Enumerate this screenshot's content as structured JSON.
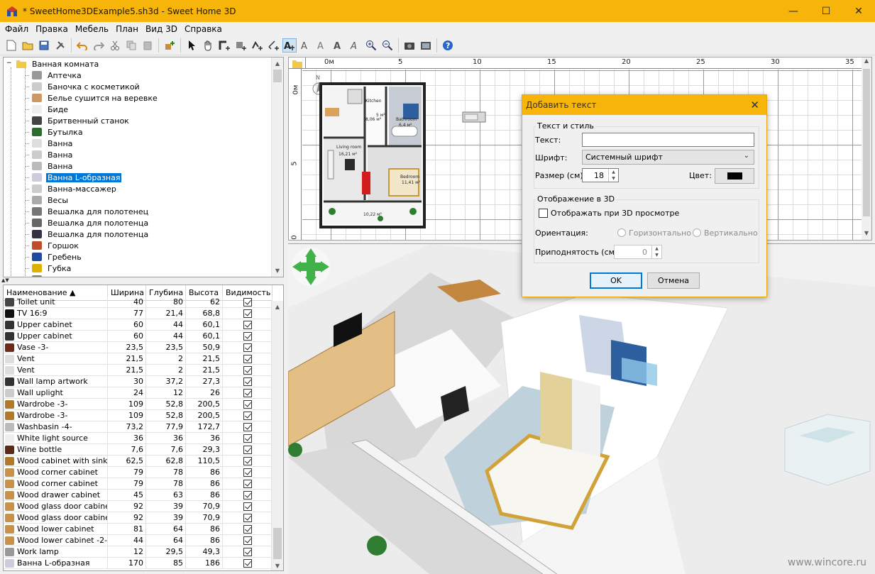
{
  "window": {
    "title": "* SweetHome3DExample5.sh3d - Sweet Home 3D",
    "minimize": "—",
    "maximize": "☐",
    "close": "✕"
  },
  "menu": [
    "Файл",
    "Правка",
    "Мебель",
    "План",
    "Вид 3D",
    "Справка"
  ],
  "catalog": {
    "category": "Ванная комната",
    "items": [
      "Аптечка",
      "Баночка с косметикой",
      "Белье сушится на веревке",
      "Биде",
      "Бритвенный станок",
      "Бутылка",
      "Ванна",
      "Ванна",
      "Ванна",
      "Ванна L-образная",
      "Ванна-массажер",
      "Весы",
      "Вешалка для полотенец",
      "Вешалка для полотенца",
      "Вешалка для полотенца",
      "Горшок",
      "Гребень",
      "Губка",
      "Дверь в душ"
    ],
    "selected_index": 9
  },
  "furniture_table": {
    "columns": [
      "Наименование ▲",
      "Ширина",
      "Глубина",
      "Высота",
      "Видимость"
    ],
    "rows": [
      {
        "name": "Toilet unit",
        "w": "40",
        "d": "80",
        "h": "62"
      },
      {
        "name": "TV 16:9",
        "w": "77",
        "d": "21,4",
        "h": "68,8"
      },
      {
        "name": "Upper cabinet",
        "w": "60",
        "d": "44",
        "h": "60,1"
      },
      {
        "name": "Upper cabinet",
        "w": "60",
        "d": "44",
        "h": "60,1"
      },
      {
        "name": "Vase -3-",
        "w": "23,5",
        "d": "23,5",
        "h": "50,9"
      },
      {
        "name": "Vent",
        "w": "21,5",
        "d": "2",
        "h": "21,5"
      },
      {
        "name": "Vent",
        "w": "21,5",
        "d": "2",
        "h": "21,5"
      },
      {
        "name": "Wall lamp artwork",
        "w": "30",
        "d": "37,2",
        "h": "27,3"
      },
      {
        "name": "Wall uplight",
        "w": "24",
        "d": "12",
        "h": "26"
      },
      {
        "name": "Wardrobe -3-",
        "w": "109",
        "d": "52,8",
        "h": "200,5"
      },
      {
        "name": "Wardrobe -3-",
        "w": "109",
        "d": "52,8",
        "h": "200,5"
      },
      {
        "name": "Washbasin -4-",
        "w": "73,2",
        "d": "77,9",
        "h": "172,7"
      },
      {
        "name": "White light source",
        "w": "36",
        "d": "36",
        "h": "36"
      },
      {
        "name": "Wine bottle",
        "w": "7,6",
        "d": "7,6",
        "h": "29,3"
      },
      {
        "name": "Wood cabinet with sink",
        "w": "62,5",
        "d": "62,8",
        "h": "110,5"
      },
      {
        "name": "Wood corner cabinet",
        "w": "79",
        "d": "78",
        "h": "86"
      },
      {
        "name": "Wood corner cabinet",
        "w": "79",
        "d": "78",
        "h": "86"
      },
      {
        "name": "Wood drawer cabinet",
        "w": "45",
        "d": "63",
        "h": "86"
      },
      {
        "name": "Wood glass door cabinet",
        "w": "92",
        "d": "39",
        "h": "70,9"
      },
      {
        "name": "Wood glass door cabinet",
        "w": "92",
        "d": "39",
        "h": "70,9"
      },
      {
        "name": "Wood lower cabinet",
        "w": "81",
        "d": "64",
        "h": "86"
      },
      {
        "name": "Wood lower cabinet -2-",
        "w": "44",
        "d": "64",
        "h": "86"
      },
      {
        "name": "Work lamp",
        "w": "12",
        "d": "29,5",
        "h": "49,3"
      },
      {
        "name": "Ванна L-образная",
        "w": "170",
        "d": "85",
        "h": "186"
      }
    ]
  },
  "plan": {
    "ruler_top": [
      "0м",
      "5",
      "10",
      "15",
      "20",
      "25",
      "30",
      "35"
    ],
    "ruler_left": [
      "0м",
      "5",
      "0"
    ],
    "rooms": {
      "kitchen": "Kitchen",
      "kitchen_area": "8,06 м²",
      "living": "Living room",
      "living_area": "16,21 м²",
      "bathroom": "Bathroom",
      "bathroom_area": "6,4 м²",
      "bedroom": "Bedroom",
      "bedroom_area": "11,41 м²",
      "hall_area": "5 м²",
      "balcony_area": "10,22 м²"
    }
  },
  "view3d": {
    "watermark": "www.wincore.ru"
  },
  "dialog": {
    "title": "Добавить текст",
    "group_text": "Текст и стиль",
    "label_text": "Текст:",
    "text_value": "",
    "label_font": "Шрифт:",
    "font_value": "Системный шрифт",
    "label_size": "Размер (см):",
    "size_value": "18",
    "label_color": "Цвет:",
    "color_value": "#000000",
    "group_3d": "Отображение в 3D",
    "show_3d_label": "Отображать при 3D просмотре",
    "orientation_label": "Ориентация:",
    "horizontal_label": "Горизонтально",
    "vertical_label": "Вертикально",
    "elevation_label": "Приподнятость (см):",
    "elevation_value": "0",
    "ok": "OK",
    "cancel": "Отмена"
  }
}
